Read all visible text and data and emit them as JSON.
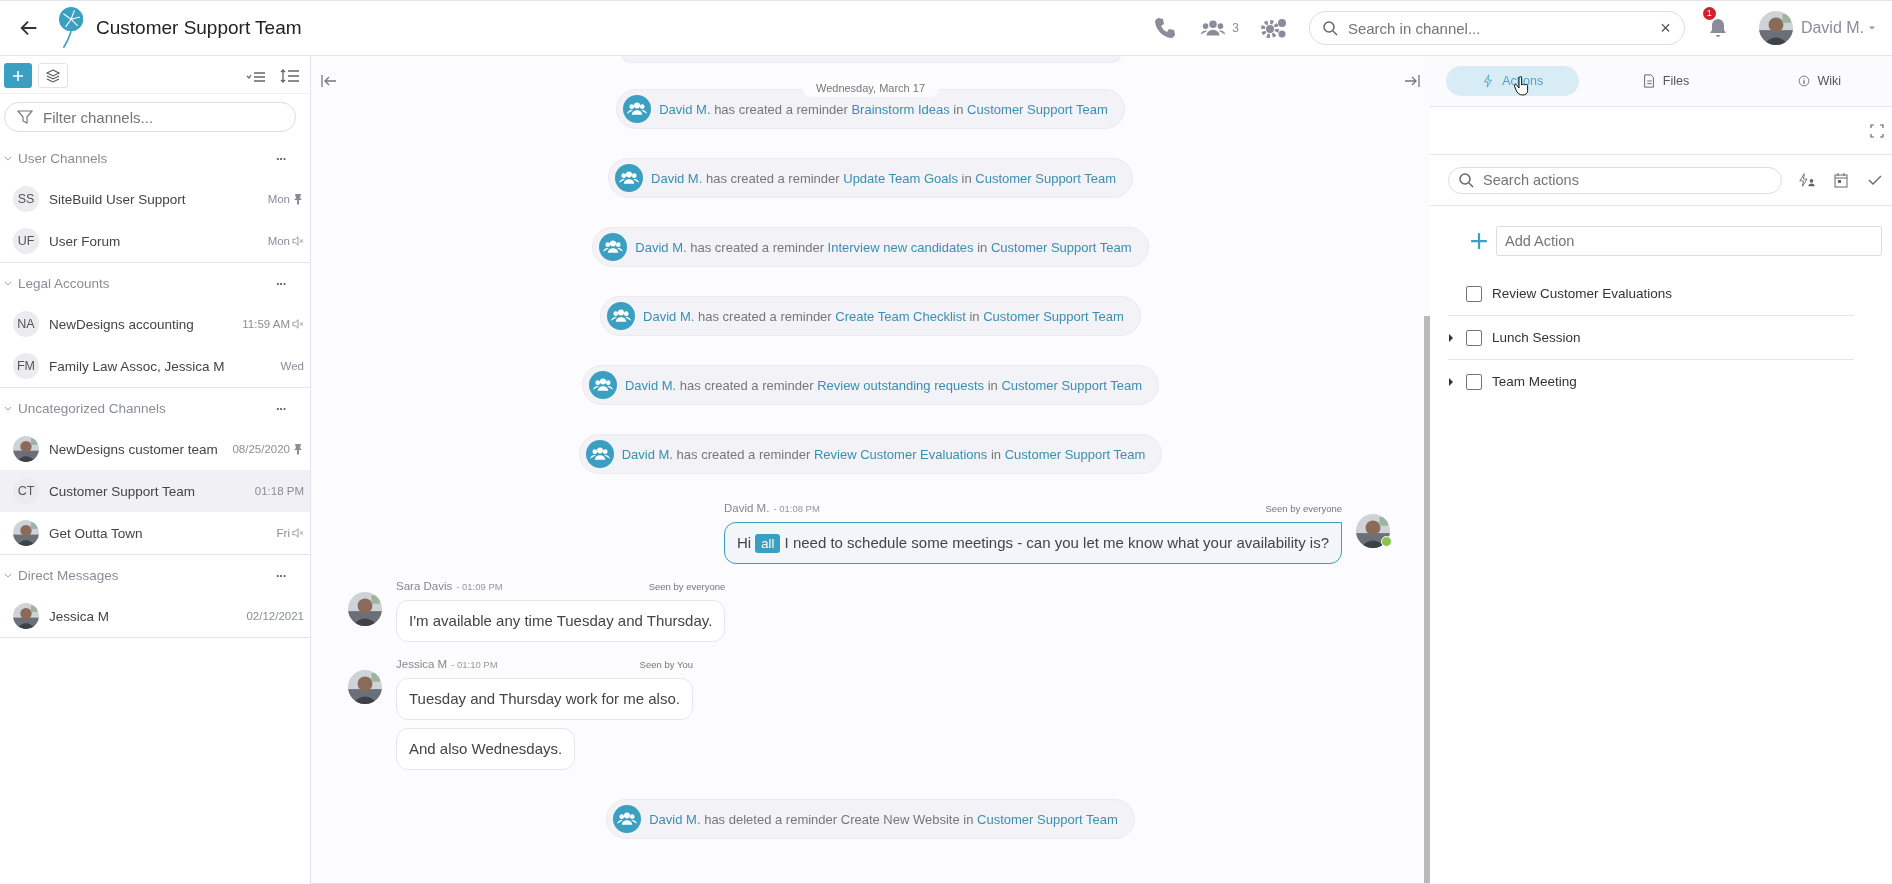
{
  "header": {
    "title": "Customer Support Team",
    "member_count": "3",
    "search": {
      "placeholder": "Search in channel..."
    },
    "clear_label": "×",
    "notifications": "1",
    "user": "David M."
  },
  "sidebar": {
    "filter": {
      "placeholder": "Filter channels..."
    },
    "sections": [
      {
        "title": "User Channels",
        "more": "···",
        "items": [
          {
            "avatar": {
              "kind": "initials",
              "text": "SS"
            },
            "name": "SiteBuild User Support",
            "time": "Mon",
            "pinned": true,
            "muted": false,
            "selected": false
          },
          {
            "avatar": {
              "kind": "initials",
              "text": "UF"
            },
            "name": "User Forum",
            "time": "Mon",
            "pinned": false,
            "muted": true,
            "selected": false
          }
        ]
      },
      {
        "title": "Legal Accounts",
        "more": "···",
        "items": [
          {
            "avatar": {
              "kind": "initials",
              "text": "NA"
            },
            "name": "NewDesigns accounting",
            "time": "11:59 AM",
            "pinned": false,
            "muted": true,
            "selected": false
          },
          {
            "avatar": {
              "kind": "initials",
              "text": "FM"
            },
            "name": "Family Law Assoc, Jessica M",
            "time": "Wed",
            "pinned": false,
            "muted": false,
            "selected": false
          }
        ]
      },
      {
        "title": "Uncategorized Channels",
        "more": "···",
        "items": [
          {
            "name": "NewDesigns customer team",
            "time": "08/25/2020",
            "pinned": true,
            "muted": false,
            "selected": false
          },
          {
            "avatar": {
              "kind": "initials",
              "text": "CT"
            },
            "name": "Customer Support Team",
            "time": "01:18 PM",
            "pinned": false,
            "muted": false,
            "selected": true
          },
          {
            "name": "Get Outta Town",
            "time": "Fri",
            "pinned": false,
            "muted": true,
            "selected": false
          }
        ]
      },
      {
        "title": "Direct Messages",
        "more": "···",
        "items": [
          {
            "name": "Jessica M",
            "time": "02/12/2021",
            "pinned": false,
            "muted": false,
            "selected": false
          }
        ]
      }
    ]
  },
  "chat": {
    "date": "Wednesday, March 17",
    "entries": [
      {
        "kind": "event",
        "segments": [
          {
            "kind": "link",
            "text": "David M."
          },
          {
            "kind": "plain",
            "text": "has created a reminder"
          },
          {
            "kind": "link",
            "text": "Brainstorm Ideas"
          },
          {
            "kind": "plain",
            "text": "in"
          },
          {
            "kind": "link",
            "text": "Customer Support Team"
          }
        ]
      },
      {
        "kind": "event",
        "segments": [
          {
            "kind": "link",
            "text": "David M."
          },
          {
            "kind": "plain",
            "text": "has created a reminder"
          },
          {
            "kind": "link",
            "text": "Update Team Goals"
          },
          {
            "kind": "plain",
            "text": "in"
          },
          {
            "kind": "link",
            "text": "Customer Support Team"
          }
        ]
      },
      {
        "kind": "event",
        "segments": [
          {
            "kind": "link",
            "text": "David M."
          },
          {
            "kind": "plain",
            "text": "has created a reminder"
          },
          {
            "kind": "link",
            "text": "Interview new candidates"
          },
          {
            "kind": "plain",
            "text": "in"
          },
          {
            "kind": "link",
            "text": "Customer Support Team"
          }
        ]
      },
      {
        "kind": "event",
        "segments": [
          {
            "kind": "link",
            "text": "David M."
          },
          {
            "kind": "plain",
            "text": "has created a reminder"
          },
          {
            "kind": "link",
            "text": "Create Team Checklist"
          },
          {
            "kind": "plain",
            "text": "in"
          },
          {
            "kind": "link",
            "text": "Customer Support Team"
          }
        ]
      },
      {
        "kind": "event",
        "segments": [
          {
            "kind": "link",
            "text": "David M."
          },
          {
            "kind": "plain",
            "text": "has created a reminder"
          },
          {
            "kind": "link",
            "text": "Review outstanding requests"
          },
          {
            "kind": "plain",
            "text": "in"
          },
          {
            "kind": "link",
            "text": "Customer Support Team"
          }
        ]
      },
      {
        "kind": "event",
        "segments": [
          {
            "kind": "link",
            "text": "David M."
          },
          {
            "kind": "plain",
            "text": "has created a reminder"
          },
          {
            "kind": "link",
            "text": "Review Customer Evaluations"
          },
          {
            "kind": "plain",
            "text": "in"
          },
          {
            "kind": "link",
            "text": "Customer Support Team"
          }
        ]
      },
      {
        "kind": "message",
        "outgoing": true,
        "author": "David M.",
        "time": "- 01:08 PM",
        "seen": "Seen by everyone",
        "online": true,
        "bubbles": [
          {
            "segments": [
              {
                "kind": "plain",
                "text": "Hi"
              },
              {
                "kind": "mention",
                "text": "all"
              },
              {
                "kind": "plain",
                "text": "I need to schedule some meetings - can you let me know what your availability is?"
              }
            ]
          }
        ]
      },
      {
        "kind": "message",
        "outgoing": false,
        "author": "Sara Davis",
        "time": "- 01:09 PM",
        "seen": "Seen by everyone",
        "online": false,
        "bubbles": [
          {
            "segments": [
              {
                "kind": "plain",
                "text": "I'm available any time Tuesday and Thursday."
              }
            ]
          }
        ]
      },
      {
        "kind": "message",
        "outgoing": false,
        "author": "Jessica M",
        "time": "- 01:10 PM",
        "seen": "Seen by You",
        "online": false,
        "bubbles": [
          {
            "segments": [
              {
                "kind": "plain",
                "text": "Tuesday and Thursday work for me also."
              }
            ]
          },
          {
            "segments": [
              {
                "kind": "plain",
                "text": "And also Wednesdays."
              }
            ]
          }
        ]
      },
      {
        "kind": "event",
        "segments": [
          {
            "kind": "link",
            "text": "David M."
          },
          {
            "kind": "plain",
            "text": "has deleted a reminder Create New Website in"
          },
          {
            "kind": "link",
            "text": "Customer Support Team"
          }
        ]
      }
    ]
  },
  "panel": {
    "tabs": [
      {
        "label": "Actions",
        "selected": true
      },
      {
        "label": "Files",
        "selected": false
      },
      {
        "label": "Wiki",
        "selected": false
      }
    ],
    "search": {
      "placeholder": "Search actions"
    },
    "add": {
      "placeholder": "Add Action"
    },
    "actions": [
      {
        "label": "Review Customer Evaluations",
        "checked": false,
        "expandable": false
      },
      {
        "label": "Lunch Session",
        "checked": false,
        "expandable": true
      },
      {
        "label": "Team Meeting",
        "checked": false,
        "expandable": true
      }
    ]
  }
}
